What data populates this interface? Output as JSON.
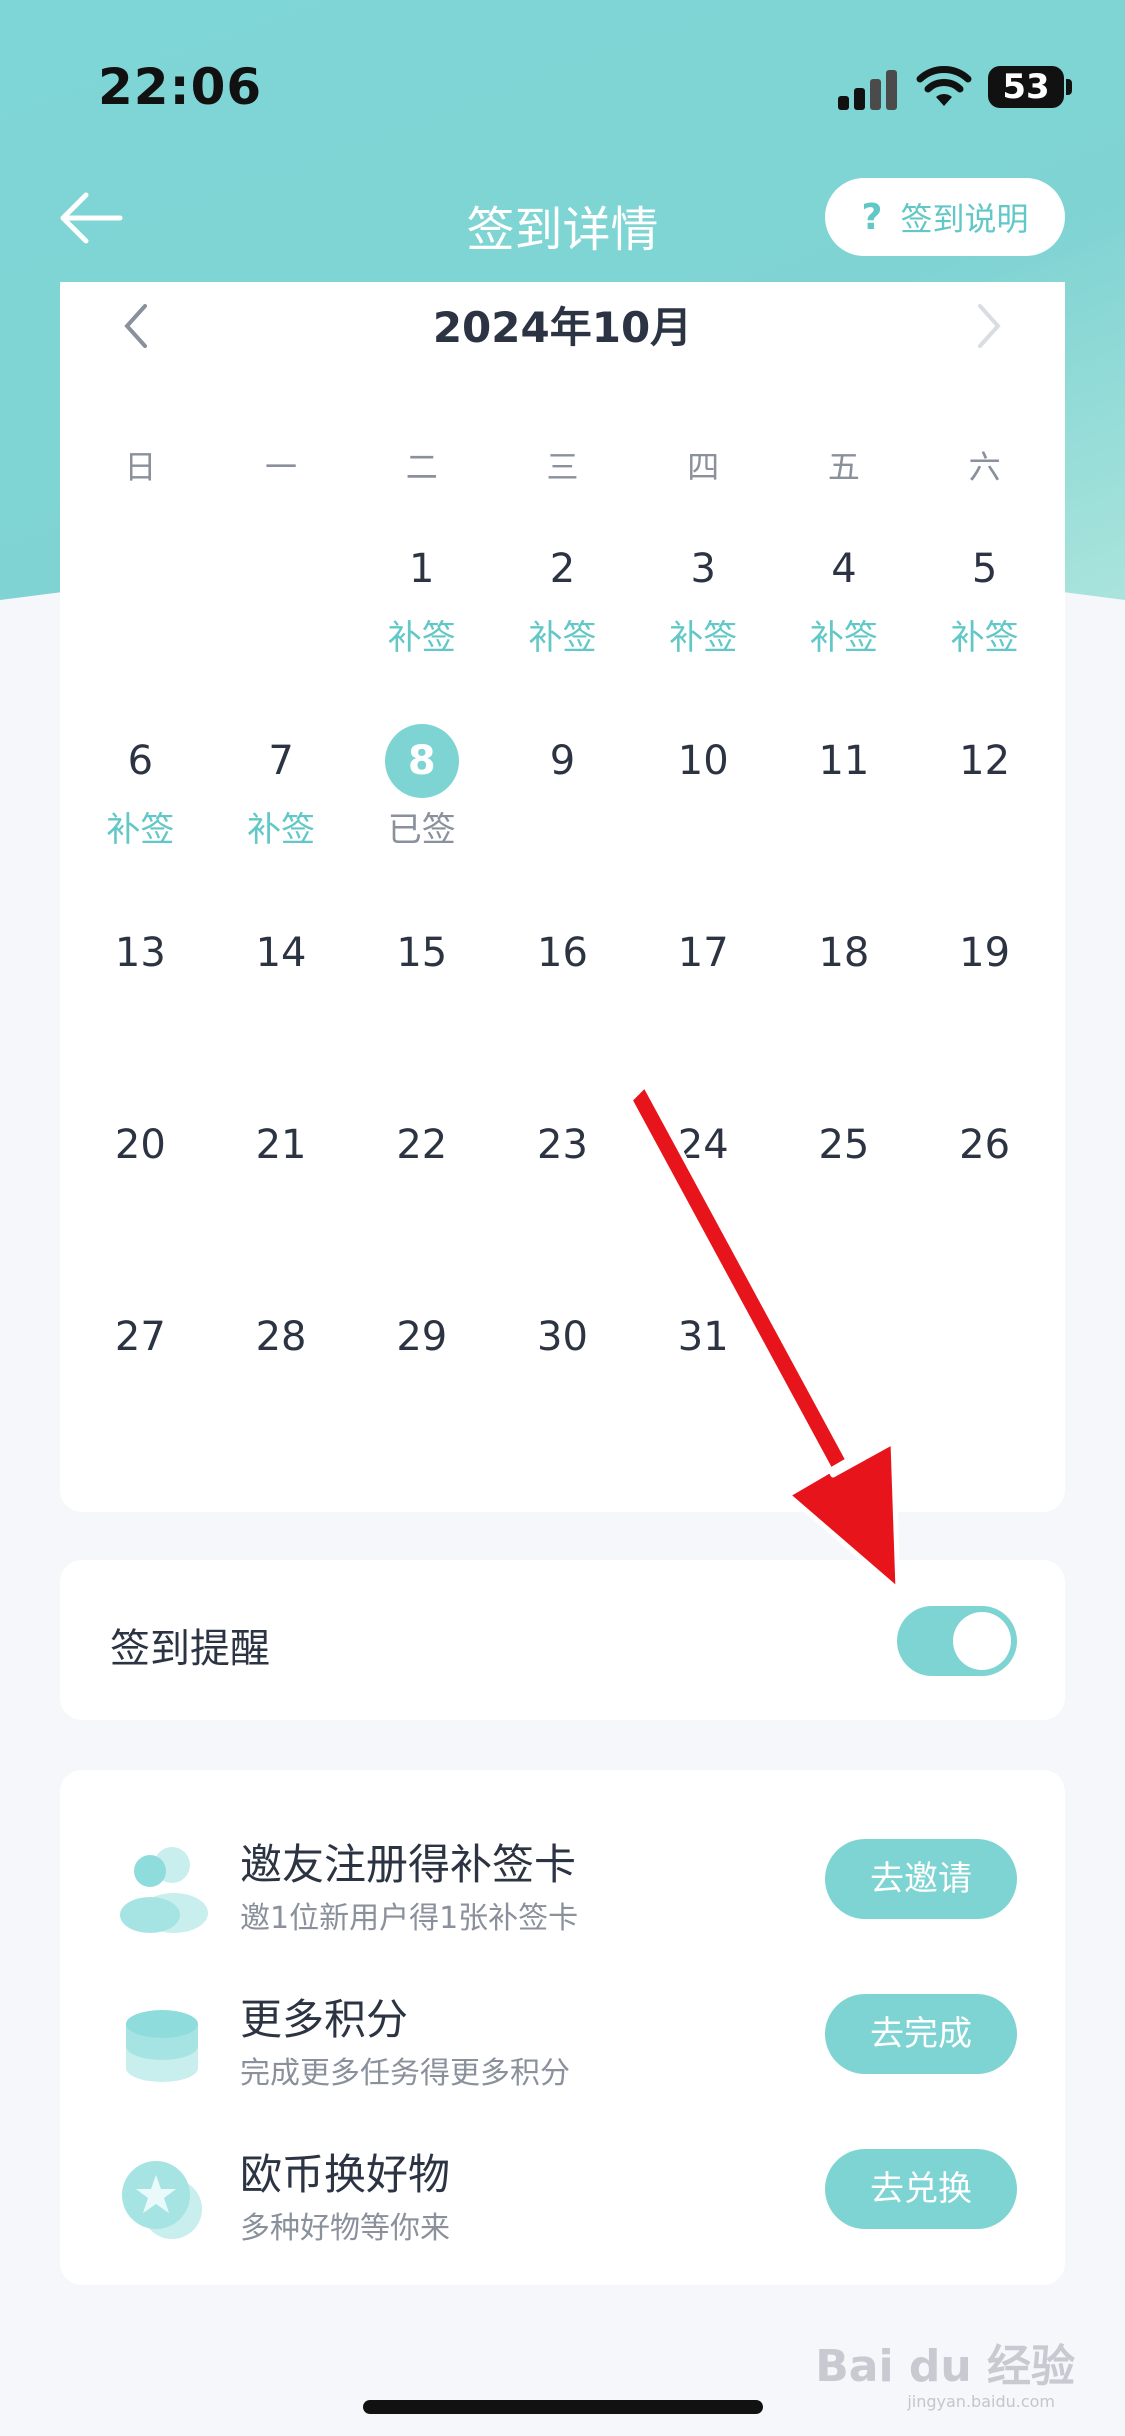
{
  "status_bar": {
    "time": "22:06",
    "battery": "53"
  },
  "nav": {
    "title": "签到详情",
    "help_icon_text": "?",
    "help_label": "签到说明"
  },
  "calendar": {
    "month_title": "2024年10月",
    "weekdays": [
      "日",
      "一",
      "二",
      "三",
      "四",
      "五",
      "六"
    ],
    "days": [
      {
        "day": "",
        "tag": ""
      },
      {
        "day": "",
        "tag": ""
      },
      {
        "day": "1",
        "tag": "补签"
      },
      {
        "day": "2",
        "tag": "补签"
      },
      {
        "day": "3",
        "tag": "补签"
      },
      {
        "day": "4",
        "tag": "补签"
      },
      {
        "day": "5",
        "tag": "补签"
      },
      {
        "day": "6",
        "tag": "补签"
      },
      {
        "day": "7",
        "tag": "补签"
      },
      {
        "day": "8",
        "tag": "已签",
        "signed": true
      },
      {
        "day": "9",
        "tag": ""
      },
      {
        "day": "10",
        "tag": ""
      },
      {
        "day": "11",
        "tag": ""
      },
      {
        "day": "12",
        "tag": ""
      },
      {
        "day": "13",
        "tag": ""
      },
      {
        "day": "14",
        "tag": ""
      },
      {
        "day": "15",
        "tag": ""
      },
      {
        "day": "16",
        "tag": ""
      },
      {
        "day": "17",
        "tag": ""
      },
      {
        "day": "18",
        "tag": ""
      },
      {
        "day": "19",
        "tag": ""
      },
      {
        "day": "20",
        "tag": ""
      },
      {
        "day": "21",
        "tag": ""
      },
      {
        "day": "22",
        "tag": ""
      },
      {
        "day": "23",
        "tag": ""
      },
      {
        "day": "24",
        "tag": ""
      },
      {
        "day": "25",
        "tag": ""
      },
      {
        "day": "26",
        "tag": ""
      },
      {
        "day": "27",
        "tag": ""
      },
      {
        "day": "28",
        "tag": ""
      },
      {
        "day": "29",
        "tag": ""
      },
      {
        "day": "30",
        "tag": ""
      },
      {
        "day": "31",
        "tag": ""
      }
    ]
  },
  "reminder": {
    "label": "签到提醒",
    "enabled": true
  },
  "tasks": [
    {
      "title": "邀友注册得补签卡",
      "subtitle": "邀1位新用户得1张补签卡",
      "button": "去邀请",
      "icon": "people-icon"
    },
    {
      "title": "更多积分",
      "subtitle": "完成更多任务得更多积分",
      "button": "去完成",
      "icon": "coins-stack-icon"
    },
    {
      "title": "欧币换好物",
      "subtitle": "多种好物等你来",
      "button": "去兑换",
      "icon": "star-coin-icon"
    }
  ],
  "watermark": {
    "logo_text": "Bai du 经验",
    "url": "jingyan.baidu.com"
  },
  "colors": {
    "accent": "#7ed3d3",
    "accent_text": "#62c7c7",
    "arrow": "#e8141b"
  }
}
